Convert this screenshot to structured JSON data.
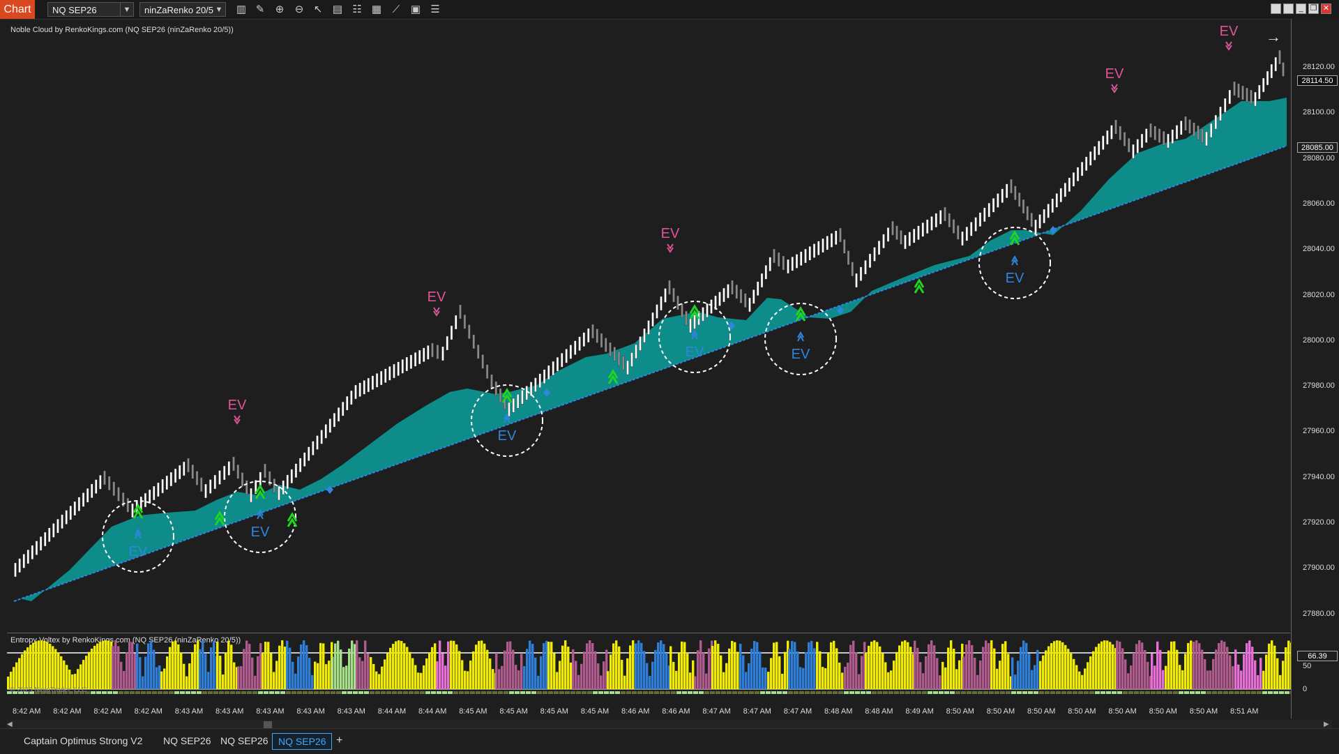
{
  "toolbar": {
    "chart_tab": "Chart",
    "instrument": "NQ SEP26",
    "bar_type": "ninZaRenko 20/5",
    "tool_icons": [
      "bar-style-icon",
      "draw-icon",
      "zoom-in-icon",
      "zoom-out-icon",
      "pointer-icon",
      "data-box-icon",
      "properties-icon",
      "templates-icon",
      "indicators-icon",
      "strategies-icon",
      "list-icon"
    ],
    "window_buttons": [
      "restore-icon",
      "restore-icon",
      "minimize-icon",
      "maximize-icon",
      "close-icon"
    ]
  },
  "price_pane": {
    "title": "Noble Cloud by RenkoKings.com (NQ SEP26 (ninZaRenko 20/5))",
    "arrow_icon": "arrow-right-icon",
    "price_ticks": [
      "28120.00",
      "28100.00",
      "28080.00",
      "28060.00",
      "28040.00",
      "28020.00",
      "28000.00",
      "27980.00",
      "27960.00",
      "27940.00",
      "27920.00",
      "27900.00",
      "27880.00"
    ],
    "last_price": "28114.50",
    "cloud_price": "28085.00",
    "ev_label": "EV",
    "colors": {
      "cloud": "#0e8c8a",
      "bull_bar": "#ffffff",
      "bear_bar": "#8a8a8a",
      "ev_bear": "#e0559a",
      "ev_bull": "#2e86de",
      "signal_green": "#1ed71e",
      "baseline": "#2e86de"
    }
  },
  "oscillator_pane": {
    "title": "Entropy Voltex by RenkoKings.com (NQ SEP26 (ninZaRenko 20/5))",
    "copyright": "© 2025 NinjaTrader, LLC",
    "value": "66.39",
    "ticks": [
      "50",
      "0"
    ],
    "corner_label": "F",
    "colors": {
      "yellow": "#f2ec00",
      "blue": "#2f7ed8",
      "mauve": "#b05b8e",
      "pink": "#e86fd8",
      "green": "#a8e08a"
    }
  },
  "time_axis": [
    "8:42 AM",
    "8:42 AM",
    "8:42 AM",
    "8:42 AM",
    "8:43 AM",
    "8:43 AM",
    "8:43 AM",
    "8:43 AM",
    "8:43 AM",
    "8:44 AM",
    "8:44 AM",
    "8:45 AM",
    "8:45 AM",
    "8:45 AM",
    "8:45 AM",
    "8:46 AM",
    "8:46 AM",
    "8:47 AM",
    "8:47 AM",
    "8:47 AM",
    "8:48 AM",
    "8:48 AM",
    "8:49 AM",
    "8:50 AM",
    "8:50 AM",
    "8:50 AM",
    "8:50 AM",
    "8:50 AM",
    "8:50 AM",
    "8:50 AM",
    "8:51 AM"
  ],
  "bottom_tabs": {
    "workspace": "Captain Optimus Strong V2",
    "tabs": [
      "NQ SEP26",
      "NQ SEP26",
      "NQ SEP26"
    ],
    "add": "+"
  }
}
